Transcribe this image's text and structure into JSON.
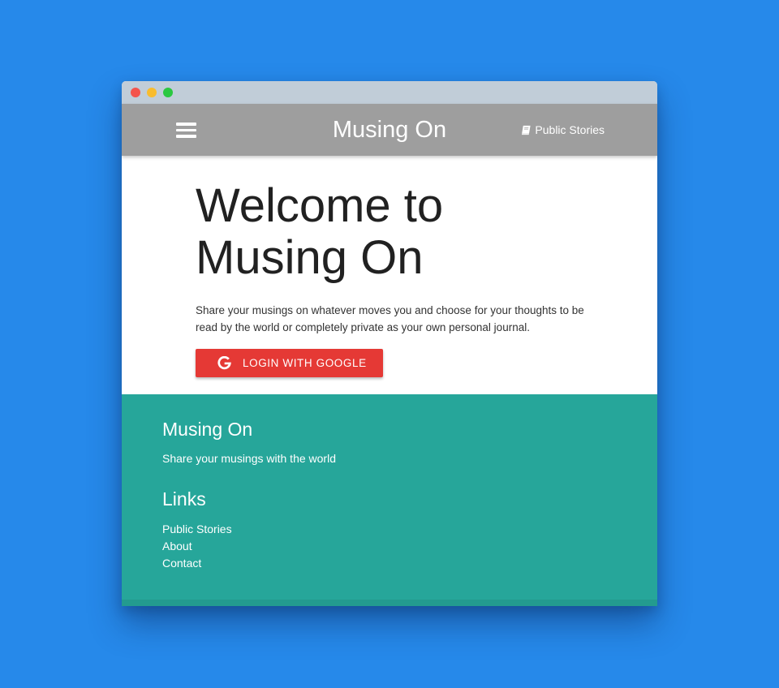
{
  "window": {
    "controls": [
      "close",
      "minimize",
      "maximize"
    ]
  },
  "navbar": {
    "menu_icon": "hamburger-menu-icon",
    "brand": "Musing On",
    "link_icon": "book-icon",
    "link_label": "Public Stories"
  },
  "hero": {
    "title_line1": "Welcome to",
    "title_line2": "Musing On",
    "description": "Share your musings on whatever moves you and choose for your thoughts to be read by the world or completely private as your own personal journal.",
    "login_icon": "google-icon",
    "login_label": "LOGIN WITH GOOGLE"
  },
  "footer": {
    "title": "Musing On",
    "tagline": "Share your musings with the world",
    "links_title": "Links",
    "links": [
      "Public Stories",
      "About",
      "Contact"
    ]
  },
  "colors": {
    "background": "#2689ea",
    "navbar": "#9e9e9e",
    "footer": "#26a69a",
    "login_button": "#e53935",
    "titlebar": "#c1cdd8"
  }
}
